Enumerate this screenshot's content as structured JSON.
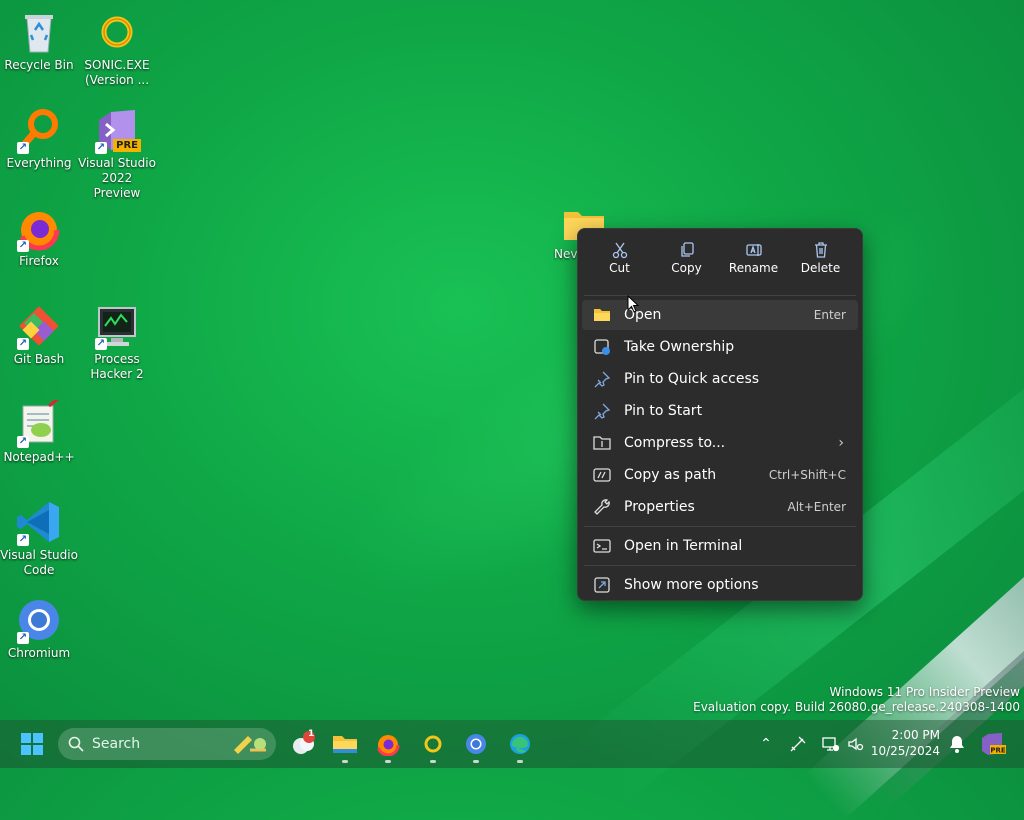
{
  "desktop": {
    "icons": [
      {
        "label": "Recycle Bin",
        "icon": "recycle-bin-icon"
      },
      {
        "label": "SONIC.EXE (Version ...",
        "icon": "sonic-exe-icon"
      },
      {
        "label": "Everything",
        "icon": "everything-icon"
      },
      {
        "label": "Visual Studio 2022 Preview",
        "icon": "visual-studio-preview-icon",
        "badge": "PRE"
      },
      {
        "label": "Firefox",
        "icon": "firefox-icon"
      },
      {
        "label": "Git Bash",
        "icon": "git-bash-icon"
      },
      {
        "label": "Process Hacker 2",
        "icon": "process-hacker-icon"
      },
      {
        "label": "Notepad++",
        "icon": "notepadpp-icon"
      },
      {
        "label": "Visual Studio Code",
        "icon": "vscode-icon"
      },
      {
        "label": "Chromium",
        "icon": "chromium-icon"
      }
    ],
    "folder_label": "Nev"
  },
  "context_menu": {
    "top_actions": [
      {
        "label": "Cut",
        "icon": "scissors-icon"
      },
      {
        "label": "Copy",
        "icon": "copy-icon"
      },
      {
        "label": "Rename",
        "icon": "rename-icon"
      },
      {
        "label": "Delete",
        "icon": "trash-icon"
      }
    ],
    "items": [
      {
        "label": "Open",
        "shortcut": "Enter",
        "icon": "folder-open-icon"
      },
      {
        "label": "Take Ownership",
        "shortcut": "",
        "icon": "take-ownership-icon"
      },
      {
        "label": "Pin to Quick access",
        "shortcut": "",
        "icon": "pin-icon"
      },
      {
        "label": "Pin to Start",
        "shortcut": "",
        "icon": "pin-icon"
      },
      {
        "label": "Compress to...",
        "shortcut": "",
        "icon": "archive-icon"
      },
      {
        "label": "Copy as path",
        "shortcut": "Ctrl+Shift+C",
        "icon": "copy-path-icon"
      },
      {
        "label": "Properties",
        "shortcut": "Alt+Enter",
        "icon": "wrench-icon"
      },
      {
        "label": "Open in Terminal",
        "shortcut": "",
        "icon": "terminal-icon"
      },
      {
        "label": "Show more options",
        "shortcut": "",
        "icon": "more-options-icon"
      }
    ]
  },
  "taskbar": {
    "search_placeholder": "Search",
    "time": "2:00 PM",
    "date": "10/25/2024",
    "notification_badge": "1"
  },
  "watermark": {
    "line1": "Windows 11 Pro Insider Preview",
    "line2": "Evaluation copy. Build 26080.ge_release.240308-1400"
  },
  "colors": {
    "accent": "#4cc2ff",
    "menu_bg": "#2c2c2c",
    "wallpaper": "#0fa646"
  }
}
